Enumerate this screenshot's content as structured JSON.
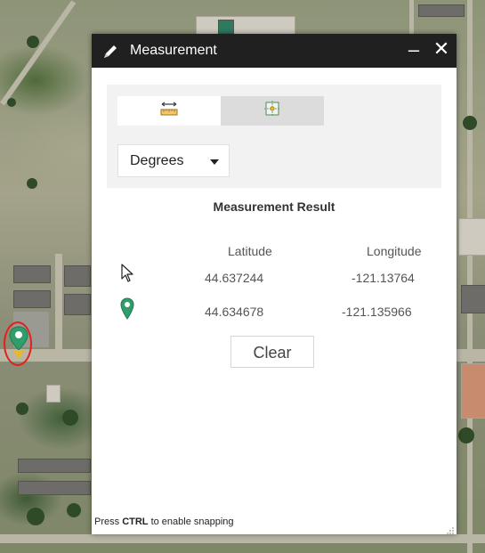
{
  "dialog": {
    "title": "Measurement",
    "title_icon": "pencil-icon",
    "minimize_label": "–",
    "close_label": "✕"
  },
  "tools": [
    {
      "name": "distance-tool",
      "icon": "ruler-distance-icon",
      "active": true
    },
    {
      "name": "location-tool",
      "icon": "location-coordinates-icon",
      "active": false
    }
  ],
  "unit": {
    "selected": "Degrees"
  },
  "result": {
    "heading": "Measurement Result",
    "columns": [
      "Latitude",
      "Longitude"
    ],
    "rows": [
      {
        "icon": "cursor-icon",
        "latitude": "44.637244",
        "longitude": "-121.13764"
      },
      {
        "icon": "map-marker-icon",
        "latitude": "44.634678",
        "longitude": "-121.135966"
      }
    ]
  },
  "clear_label": "Clear",
  "snap_hint": {
    "key": "CTRL",
    "prefix": "Press ",
    "suffix": " to enable snapping"
  },
  "colors": {
    "titlebar": "#202020",
    "marker_green": "#2f9e6b",
    "marker_yellow": "#e8b72c",
    "highlight_red": "#e0211d"
  }
}
